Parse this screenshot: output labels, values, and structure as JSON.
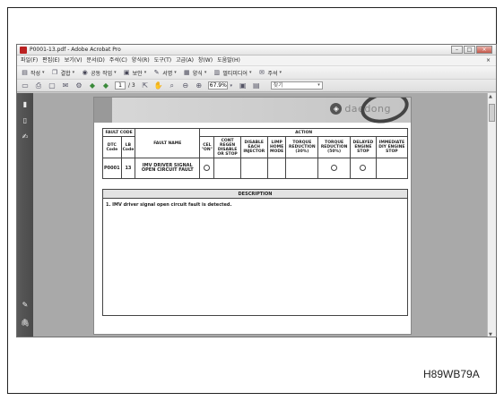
{
  "window": {
    "title": "P0001-13.pdf - Adobe Acrobat Pro"
  },
  "menubar": {
    "items": [
      "파일(F)",
      "편집(E)",
      "보기(V)",
      "문서(D)",
      "주석(C)",
      "양식(R)",
      "도구(T)",
      "고급(A)",
      "창(W)",
      "도움말(H)"
    ],
    "close": "×"
  },
  "toolbar1": {
    "items": [
      {
        "icon": "create-icon",
        "label": "작성"
      },
      {
        "icon": "combine-icon",
        "label": "결합"
      },
      {
        "icon": "collaborate-icon",
        "label": "공동 작업"
      },
      {
        "icon": "secure-icon",
        "label": "보안"
      },
      {
        "icon": "sign-icon",
        "label": "서명"
      },
      {
        "icon": "forms-icon",
        "label": "양식"
      },
      {
        "icon": "multimedia-icon",
        "label": "멀티미디어"
      },
      {
        "icon": "comment-icon",
        "label": "주석"
      }
    ]
  },
  "toolbar2": {
    "page_current": "1",
    "page_total": "/ 3",
    "zoom": "67.9%",
    "find_placeholder": "찾기"
  },
  "document": {
    "logo_text": "daedong",
    "table": {
      "fault_code_header": "FAULT CODE",
      "fault_name_header": "FAULT NAME",
      "action_header": "ACTION",
      "dtc_code_header": "DTC Code",
      "lb_code_header": "LB Code",
      "action_columns": [
        "CEL \"ON\"",
        "CONT REGEN DISABLE OR STOP",
        "DISABLE EACH INJECTOR",
        "LIMP HOME MODE",
        "TORQUE REDUCTION (30%)",
        "TORQUE REDUCTION (50%)",
        "DELAYED ENGINE STOP",
        "IMMEDIATE DIY ENGINE STOP"
      ],
      "row": {
        "dtc": "P0001",
        "lb": "13",
        "name": "IMV DRIVER SIGNAL OPEN CIRCUIT FAULT",
        "marks": [
          true,
          false,
          false,
          false,
          false,
          true,
          true,
          false
        ]
      }
    },
    "description_header": "DESCRIPTION",
    "description_text": "1.  IMV driver signal open circuit fault is detected."
  },
  "caption": "H89WB79A"
}
